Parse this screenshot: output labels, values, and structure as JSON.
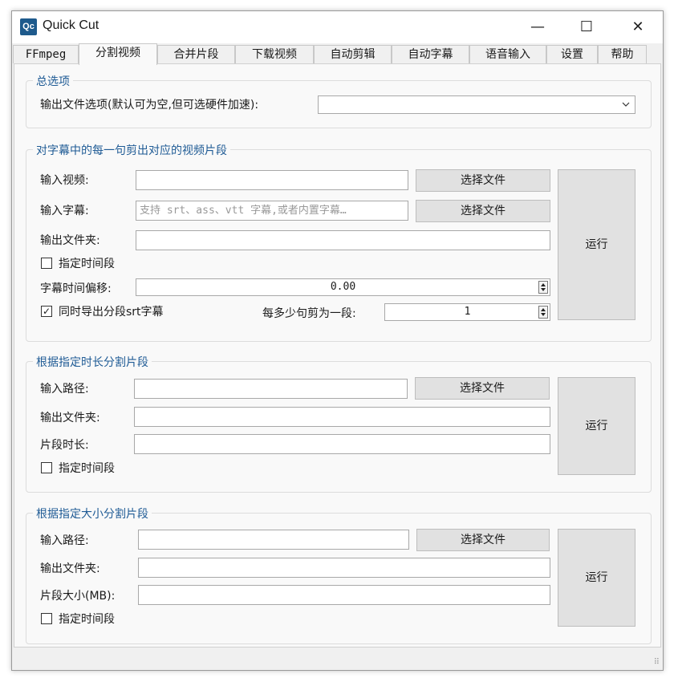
{
  "window": {
    "app_icon": "Qc",
    "title": "Quick Cut",
    "minimize": "—",
    "maximize": "☐",
    "close": "✕"
  },
  "tabs": [
    "FFmpeg",
    "分割视频",
    "合并片段",
    "下载视频",
    "自动剪辑",
    "自动字幕",
    "语音输入",
    "设置",
    "帮助"
  ],
  "active_tab": "分割视频",
  "general": {
    "title": "总选项",
    "output_options_label": "输出文件选项(默认可为空,但可选硬件加速):",
    "output_options_value": ""
  },
  "by_subtitle": {
    "title": "对字幕中的每一句剪出对应的视频片段",
    "input_video_label": "输入视频:",
    "input_video_value": "",
    "input_subtitle_label": "输入字幕:",
    "input_subtitle_placeholder": "支持 srt、ass、vtt 字幕,或者内置字幕…",
    "output_folder_label": "输出文件夹:",
    "output_folder_value": "",
    "choose_file": "选择文件",
    "time_range_label": "指定时间段",
    "time_range_checked": false,
    "offset_label": "字幕时间偏移:",
    "offset_value": "0.00",
    "export_srt_label": "同时导出分段srt字幕",
    "export_srt_checked": true,
    "every_n_label": "每多少句剪为一段:",
    "every_n_value": "1",
    "run": "运行"
  },
  "by_duration": {
    "title": "根据指定时长分割片段",
    "input_path_label": "输入路径:",
    "input_path_value": "",
    "choose_file": "选择文件",
    "output_folder_label": "输出文件夹:",
    "output_folder_value": "",
    "segment_duration_label": "片段时长:",
    "segment_duration_value": "",
    "time_range_label": "指定时间段",
    "time_range_checked": false,
    "run": "运行"
  },
  "by_size": {
    "title": "根据指定大小分割片段",
    "input_path_label": "输入路径:",
    "input_path_value": "",
    "choose_file": "选择文件",
    "output_folder_label": "输出文件夹:",
    "output_folder_value": "",
    "segment_size_label": "片段大小(MB):",
    "segment_size_value": "",
    "time_range_label": "指定时间段",
    "time_range_checked": false,
    "run": "运行"
  },
  "status": {
    "grip": "⠿"
  }
}
